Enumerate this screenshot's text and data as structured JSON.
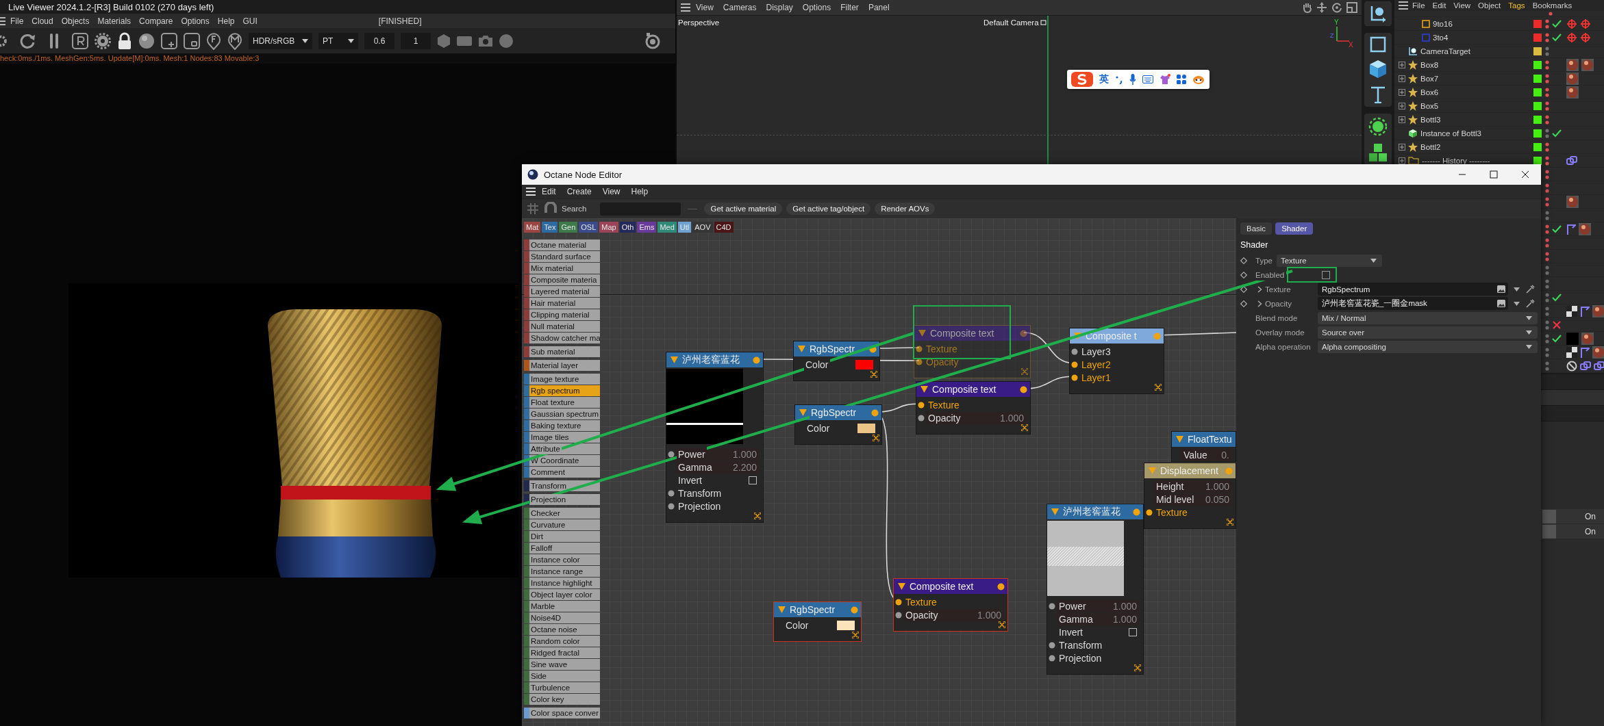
{
  "live_viewer": {
    "title": "Live Viewer 2024.1.2-[R3] Build 0102 (270 days left)",
    "menu": [
      "File",
      "Cloud",
      "Objects",
      "Materials",
      "Compare",
      "Options",
      "Help",
      "GUI"
    ],
    "status": "[FINISHED]",
    "toolbar": {
      "color_space": "HDR/sRGB",
      "kernel": "PT",
      "value_1": "0.6",
      "value_2": "1"
    },
    "stats": "heck:0ms./1ms. MeshGen:5ms. Update[M]:0ms. Mesh:1 Nodes:83 Movable:3"
  },
  "viewport": {
    "menu": [
      "View",
      "Cameras",
      "Display",
      "Options",
      "Filter",
      "Panel"
    ],
    "view_name": "Perspective",
    "camera": "Default Camera",
    "axis_labels": [
      "Y",
      "Z",
      "X"
    ]
  },
  "ime_toolbar": {
    "mode": "英"
  },
  "object_manager": {
    "menu": [
      {
        "label": "File",
        "selected": false
      },
      {
        "label": "Edit",
        "selected": false
      },
      {
        "label": "View",
        "selected": false
      },
      {
        "label": "Object",
        "selected": false
      },
      {
        "label": "Tags",
        "selected": true
      },
      {
        "label": "Bookmarks",
        "selected": false
      }
    ],
    "objects": [
      {
        "kind": "clipped",
        "dot": {
          "color": "#e05050"
        },
        "children": [
          {
            "name": "9to16",
            "kind": "rectangle",
            "expander": false,
            "color": "#ee2b2b",
            "dot": {
              "color": "#e05050"
            },
            "checked": true,
            "crossed": false,
            "tags": [
              {
                "kind": "target"
              },
              {
                "kind": "target"
              }
            ]
          },
          {
            "name": "3to4",
            "kind": "square",
            "expander": false,
            "color": "#ee2b2b",
            "dot": {
              "color": "#e05050"
            },
            "checked": true,
            "crossed": false,
            "tags": [
              {
                "kind": "target"
              },
              {
                "kind": "target"
              }
            ]
          }
        ]
      },
      {
        "name": "CameraTarget",
        "kind": "target",
        "expander": false,
        "color": "#d9bb3f",
        "dot": {
          "color": "#707070"
        },
        "checked": false,
        "crossed": false
      },
      {
        "name": "Box8",
        "kind": "star",
        "expander": true,
        "color": "#44ee11",
        "dot": {
          "color": "#e05050"
        },
        "checked": false,
        "crossed": false,
        "tags": [
          {
            "kind": "material"
          },
          {
            "kind": "material"
          }
        ]
      },
      {
        "name": "Box7",
        "kind": "star",
        "expander": true,
        "color": "#44ee11",
        "dot": {
          "color": "#e05050"
        },
        "checked": false,
        "crossed": false,
        "tags": [
          {
            "kind": "material"
          }
        ]
      },
      {
        "name": "Box6",
        "kind": "star",
        "expander": true,
        "color": "#44ee11",
        "dot": {
          "color": "#e05050"
        },
        "checked": false,
        "crossed": false,
        "tags": [
          {
            "kind": "material"
          }
        ]
      },
      {
        "name": "Box5",
        "kind": "star",
        "expander": true,
        "color": "#44ee11",
        "dot": {
          "color": "#e05050"
        },
        "checked": false,
        "crossed": false
      },
      {
        "name": "Bottl3",
        "kind": "star",
        "expander": true,
        "color": "#44ee11",
        "dot": {
          "color": "#e05050"
        },
        "checked": false,
        "crossed": false
      },
      {
        "name": "Instance of Bottl3",
        "kind": "instance",
        "expander": false,
        "color": "#44ee11",
        "dot": {
          "color": "#707070"
        },
        "checked": true,
        "crossed": false
      },
      {
        "name": "Bottl2",
        "kind": "star",
        "expander": true,
        "color": "#44ee11",
        "dot": {
          "color": "#e05050"
        },
        "checked": false,
        "crossed": false
      },
      {
        "name": "------- History --------",
        "kind": "folder",
        "expander": true,
        "color": "#44ee11",
        "dot": {
          "color": "#e05050"
        },
        "checked": false,
        "crossed": false,
        "tags": [
          {
            "kind": "python"
          }
        ]
      }
    ],
    "hidden_rows": [
      {
        "dot": {
          "color": "#e05050"
        },
        "checked": false,
        "crossed": false
      },
      {
        "dot": {
          "color": "#e05050"
        },
        "checked": false,
        "crossed": false
      },
      {
        "dot": {
          "color": "#e05050"
        },
        "checked": false,
        "crossed": false,
        "tags": [
          {
            "kind": "material"
          }
        ]
      },
      {
        "dot": {
          "color": "#707070"
        },
        "checked": false,
        "crossed": false
      },
      {
        "dot": {
          "color": "#e05050"
        },
        "checked": true,
        "crossed": false,
        "tags": [
          {
            "kind": "flag"
          },
          {
            "kind": "material"
          }
        ]
      },
      {
        "dot": {
          "color": "#e05050"
        },
        "checked": false,
        "crossed": false
      },
      {
        "dot": {
          "color": "#e05050"
        },
        "checked": false,
        "crossed": false
      },
      {
        "dot": {
          "color": "#707070"
        },
        "checked": false,
        "crossed": false
      },
      {
        "dot": {
          "color": "#707070"
        },
        "checked": false,
        "crossed": false
      },
      {
        "dot": {
          "color": "#707070"
        },
        "checked": true,
        "crossed": false
      },
      {
        "dot": {
          "color": "#707070"
        },
        "checked": false,
        "crossed": false,
        "tags": [
          {
            "kind": "checker"
          },
          {
            "kind": "flag"
          },
          {
            "kind": "material"
          }
        ]
      },
      {
        "dot": {
          "color": "#707070"
        },
        "checked": false,
        "crossed": true
      },
      {
        "dot": {
          "color": "#707070"
        },
        "checked": true,
        "crossed": false,
        "tags": [
          {
            "kind": "black"
          },
          {
            "kind": "material"
          }
        ]
      },
      {
        "dot": {
          "color": "#707070"
        },
        "checked": false,
        "crossed": false,
        "tags": [
          {
            "kind": "checker"
          },
          {
            "kind": "flag"
          },
          {
            "kind": "material"
          }
        ]
      },
      {
        "dot": {
          "color": "#707070"
        },
        "checked": false,
        "crossed": false,
        "tags": [
          {
            "kind": "blocked"
          },
          {
            "kind": "python"
          },
          {
            "kind": "python"
          }
        ]
      }
    ],
    "attribute_rows": [
      {
        "value": "On"
      },
      {
        "value": "On"
      }
    ]
  },
  "node_editor": {
    "title": "Octane Node Editor",
    "menu": [
      "Edit",
      "Create",
      "View",
      "Help"
    ],
    "search_label": "Search",
    "buttons": [
      "Get active material",
      "Get active tag/object",
      "Render AOVs"
    ],
    "categories": [
      {
        "label": "Mat",
        "color": "#9b4444"
      },
      {
        "label": "Tex",
        "color": "#2e6aa0"
      },
      {
        "label": "Gen",
        "color": "#3d7a4a"
      },
      {
        "label": "OSL",
        "color": "#3a4c8c"
      },
      {
        "label": "Map",
        "color": "#9b4458"
      },
      {
        "label": "Oth",
        "color": "#23295a"
      },
      {
        "label": "Ems",
        "color": "#6a3a9a"
      },
      {
        "label": "Med",
        "color": "#2f8a78"
      },
      {
        "label": "Utl",
        "color": "#6fa2d2"
      },
      {
        "label": "AOV",
        "color": "#363636"
      },
      {
        "label": "C4D",
        "color": "#4a1515"
      }
    ],
    "node_palette": [
      {
        "color": "#8e3b3b",
        "items": [
          {
            "label": "Octane material",
            "selected": false
          },
          {
            "label": "Standard surface",
            "selected": false
          },
          {
            "label": "Mix material",
            "selected": false
          },
          {
            "label": "Composite materia",
            "selected": false
          },
          {
            "label": "Layered material",
            "selected": false
          },
          {
            "label": "Hair material",
            "selected": false
          },
          {
            "label": "Clipping material",
            "selected": false
          },
          {
            "label": "Null material",
            "selected": false
          },
          {
            "label": "Shadow catcher ma",
            "selected": false
          }
        ]
      },
      {
        "color": "#8e3b3b",
        "items": [
          {
            "label": "Sub material",
            "selected": false
          }
        ]
      },
      {
        "color": "#b0561a",
        "items": [
          {
            "label": "Material layer",
            "selected": false
          }
        ]
      },
      {
        "color": "#2f6ea3",
        "items": [
          {
            "label": "Image texture",
            "selected": false
          },
          {
            "label": "Rgb spectrum",
            "selected": true
          },
          {
            "label": "Float texture",
            "selected": false
          },
          {
            "label": "Gaussian spectrum",
            "selected": false
          },
          {
            "label": "Baking texture",
            "selected": false
          },
          {
            "label": "Image tiles",
            "selected": false
          },
          {
            "label": "Attribute",
            "selected": false
          },
          {
            "label": "W Coordinate",
            "selected": false
          },
          {
            "label": "Comment",
            "selected": false
          }
        ]
      },
      {
        "color": "#22294d",
        "items": [
          {
            "label": "Transform",
            "selected": false
          }
        ]
      },
      {
        "color": "#22294d",
        "items": [
          {
            "label": "Projection",
            "selected": false
          }
        ]
      },
      {
        "color": "#3f6b3f",
        "items": [
          {
            "label": "Checker",
            "selected": false
          },
          {
            "label": "Curvature",
            "selected": false
          },
          {
            "label": "Dirt",
            "selected": false
          },
          {
            "label": "Falloff",
            "selected": false
          },
          {
            "label": "Instance color",
            "selected": false
          },
          {
            "label": "Instance range",
            "selected": false
          },
          {
            "label": "Instance highlight",
            "selected": false
          },
          {
            "label": "Object layer color",
            "selected": false
          },
          {
            "label": "Marble",
            "selected": false
          },
          {
            "label": "Noise4D",
            "selected": false
          },
          {
            "label": "Octane noise",
            "selected": false
          },
          {
            "label": "Random color",
            "selected": false
          },
          {
            "label": "Ridged fractal",
            "selected": false
          },
          {
            "label": "Sine wave",
            "selected": false
          },
          {
            "label": "Side",
            "selected": false
          },
          {
            "label": "Turbulence",
            "selected": false
          },
          {
            "label": "Color key",
            "selected": false
          }
        ]
      },
      {
        "color": "#6a9ad0",
        "items": [
          {
            "label": "Color space conver",
            "selected": false
          }
        ]
      }
    ],
    "nodes": [
      {
        "kind": "image",
        "title": "泸州老窖蓝花",
        "faded": false,
        "flagged": false,
        "preview": {
          "kind": "dark"
        },
        "inputs": [
          {
            "kind": "value",
            "label": "Power",
            "value": "1.000",
            "socket": true,
            "linked": false
          },
          {
            "kind": "value",
            "label": "Gamma",
            "value": "2.200",
            "socket": false,
            "linked": false
          },
          {
            "kind": "checkbox",
            "label": "Invert",
            "checked": false,
            "socket": false,
            "linked": false
          },
          {
            "kind": "plain",
            "label": "Transform",
            "socket": true,
            "linked": false
          },
          {
            "kind": "plain",
            "label": "Projection",
            "socket": true,
            "linked": false
          }
        ]
      },
      {
        "kind": "rgb",
        "title": "RgbSpectr",
        "faded": false,
        "flagged": false,
        "inputs": [
          {
            "kind": "color",
            "label": "Color",
            "color": "#ff0000",
            "socket": false,
            "linked": false
          }
        ]
      },
      {
        "kind": "composite",
        "title": "Composite text",
        "faded": true,
        "flagged": false,
        "inputs": [
          {
            "kind": "plain",
            "label": "Texture",
            "socket": true,
            "linked": true
          },
          {
            "kind": "plain",
            "label": "Opacity",
            "socket": true,
            "linked": true
          }
        ]
      },
      {
        "kind": "rgb",
        "title": "RgbSpectr",
        "faded": false,
        "flagged": false,
        "inputs": [
          {
            "kind": "color",
            "label": "Color",
            "color": "#ebc487",
            "socket": false,
            "linked": false
          }
        ]
      },
      {
        "kind": "composite",
        "title": "Composite text",
        "faded": false,
        "flagged": false,
        "inputs": [
          {
            "kind": "plain",
            "label": "Texture",
            "socket": true,
            "linked": true
          },
          {
            "kind": "value",
            "label": "Opacity",
            "value": "1.000",
            "socket": true,
            "linked": false
          }
        ]
      },
      {
        "kind": "layers",
        "title": "Composite t",
        "faded": false,
        "flagged": false,
        "inputs": [
          {
            "kind": "plain",
            "label": "Layer3",
            "socket": true,
            "linked": false
          },
          {
            "kind": "plain",
            "label": "Layer2",
            "socket": true,
            "linked": true
          },
          {
            "kind": "plain",
            "label": "Layer1",
            "socket": true,
            "linked": true
          }
        ]
      },
      {
        "kind": "float",
        "title": "FloatTextu",
        "faded": false,
        "flagged": false,
        "inputs": [
          {
            "kind": "value",
            "label": "Value",
            "value": "0.",
            "socket": false,
            "linked": false
          }
        ]
      },
      {
        "kind": "displacement",
        "title": "Displacement",
        "faded": false,
        "flagged": false,
        "inputs": [
          {
            "kind": "value",
            "label": "Height",
            "value": "1.000",
            "socket": false,
            "linked": false
          },
          {
            "kind": "value",
            "label": "Mid level",
            "value": "0.050",
            "socket": false,
            "linked": false
          },
          {
            "kind": "plain",
            "label": "Texture",
            "socket": true,
            "linked": true
          }
        ]
      },
      {
        "kind": "rgb",
        "title": "RgbSpectr",
        "faded": false,
        "flagged": true,
        "inputs": [
          {
            "kind": "color",
            "label": "Color",
            "color": "#fde3bb",
            "socket": false,
            "linked": false
          }
        ]
      },
      {
        "kind": "composite",
        "title": "Composite text",
        "faded": false,
        "flagged": true,
        "inputs": [
          {
            "kind": "plain",
            "label": "Texture",
            "socket": true,
            "linked": true
          },
          {
            "kind": "value",
            "label": "Opacity",
            "value": "1.000",
            "socket": true,
            "linked": false
          }
        ]
      },
      {
        "kind": "image",
        "title": "泸州老窖蓝花",
        "faded": false,
        "flagged": false,
        "preview": {
          "kind": "light"
        },
        "inputs": [
          {
            "kind": "value",
            "label": "Power",
            "value": "1.000",
            "socket": true,
            "linked": false
          },
          {
            "kind": "value",
            "label": "Gamma",
            "value": "1.000",
            "socket": false,
            "linked": false
          },
          {
            "kind": "checkbox",
            "label": "Invert",
            "checked": false,
            "socket": false,
            "linked": false
          },
          {
            "kind": "plain",
            "label": "Transform",
            "socket": true,
            "linked": false
          },
          {
            "kind": "plain",
            "label": "Projection",
            "socket": true,
            "linked": false
          }
        ]
      }
    ],
    "inspector": {
      "tabs": [
        {
          "label": "Basic",
          "selected": false
        },
        {
          "label": "Shader",
          "selected": true
        }
      ],
      "heading": "Shader",
      "fields": [
        {
          "kind": "dropdown",
          "label": "Type",
          "value": "Texture",
          "keyframe": true,
          "expandable": false
        },
        {
          "kind": "checkbox",
          "label": "Enabled",
          "checked": false,
          "keyframe": true,
          "expandable": false
        },
        {
          "kind": "link",
          "label": "Texture",
          "value": "RgbSpectrum",
          "keyframe": true,
          "expandable": true
        },
        {
          "kind": "link",
          "label": "Opacity",
          "value": "泸州老窖蓝花瓷_一圈金mask",
          "keyframe": true,
          "expandable": true
        },
        {
          "kind": "select",
          "label": "Blend mode",
          "value": "Mix / Normal",
          "keyframe": false,
          "expandable": false
        },
        {
          "kind": "select",
          "label": "Overlay mode",
          "value": "Source over",
          "keyframe": false,
          "expandable": false
        },
        {
          "kind": "select",
          "label": "Alpha operation",
          "value": "Alpha compositing",
          "keyframe": false,
          "expandable": false
        }
      ]
    }
  }
}
